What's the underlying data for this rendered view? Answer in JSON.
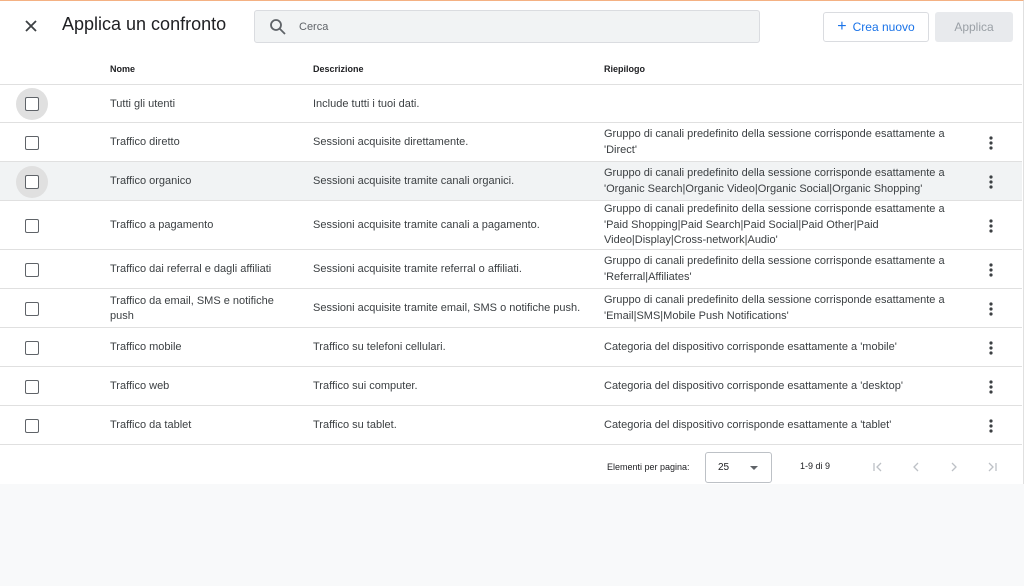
{
  "header": {
    "title": "Applica un confronto",
    "search_placeholder": "Cerca",
    "new_label": "Crea nuovo",
    "apply_label": "Applica",
    "icons": {
      "close": "close-icon",
      "search": "search-icon",
      "add": "plus-icon"
    }
  },
  "table": {
    "columns": {
      "name": "Nome",
      "description": "Descrizione",
      "summary": "Riepilogo"
    },
    "rows": [
      {
        "name": "Tutti gli utenti",
        "description": "Include tutti i tuoi dati.",
        "summary": "",
        "checked": false,
        "has_menu": false
      },
      {
        "name": "Traffico diretto",
        "description": "Sessioni acquisite direttamente.",
        "summary": "Gruppo di canali predefinito della sessione corrisponde esattamente a 'Direct'",
        "checked": false,
        "has_menu": true
      },
      {
        "name": "Traffico organico",
        "description": "Sessioni acquisite tramite canali organici.",
        "summary": "Gruppo di canali predefinito della sessione corrisponde esattamente a 'Organic Search|Organic Video|Organic Social|Organic Shopping'",
        "checked": false,
        "has_menu": true
      },
      {
        "name": "Traffico a pagamento",
        "description": "Sessioni acquisite tramite canali a pagamento.",
        "summary": "Gruppo di canali predefinito della sessione corrisponde esattamente a 'Paid Shopping|Paid Search|Paid Social|Paid Other|Paid Video|Display|Cross-network|Audio'",
        "checked": false,
        "has_menu": true
      },
      {
        "name": "Traffico dai referral e dagli affiliati",
        "description": "Sessioni acquisite tramite referral o affiliati.",
        "summary": "Gruppo di canali predefinito della sessione corrisponde esattamente a 'Referral|Affiliates'",
        "checked": false,
        "has_menu": true
      },
      {
        "name": "Traffico da email, SMS e notifiche push",
        "description": "Sessioni acquisite tramite email, SMS o notifiche push.",
        "summary": "Gruppo di canali predefinito della sessione corrisponde esattamente a 'Email|SMS|Mobile Push Notifications'",
        "checked": false,
        "has_menu": true
      },
      {
        "name": "Traffico mobile",
        "description": "Traffico su telefoni cellulari.",
        "summary": "Categoria del dispositivo corrisponde esattamente a 'mobile'",
        "checked": false,
        "has_menu": true
      },
      {
        "name": "Traffico web",
        "description": "Traffico sui computer.",
        "summary": "Categoria del dispositivo corrisponde esattamente a 'desktop'",
        "checked": false,
        "has_menu": true
      },
      {
        "name": "Traffico da tablet",
        "description": "Traffico su tablet.",
        "summary": "Categoria del dispositivo corrisponde esattamente a 'tablet'",
        "checked": false,
        "has_menu": true
      }
    ]
  },
  "pagination": {
    "items_per_page_label": "Elementi per pagina:",
    "items_per_page": "25",
    "range": "1-9 di 9",
    "icons": [
      "first-page-icon",
      "previous-page-icon",
      "next-page-icon",
      "last-page-icon"
    ]
  },
  "colors": {
    "accent": "#1a73e8",
    "row_highlight": "#f1f3f4",
    "disabled_button": "#e8eaed"
  }
}
